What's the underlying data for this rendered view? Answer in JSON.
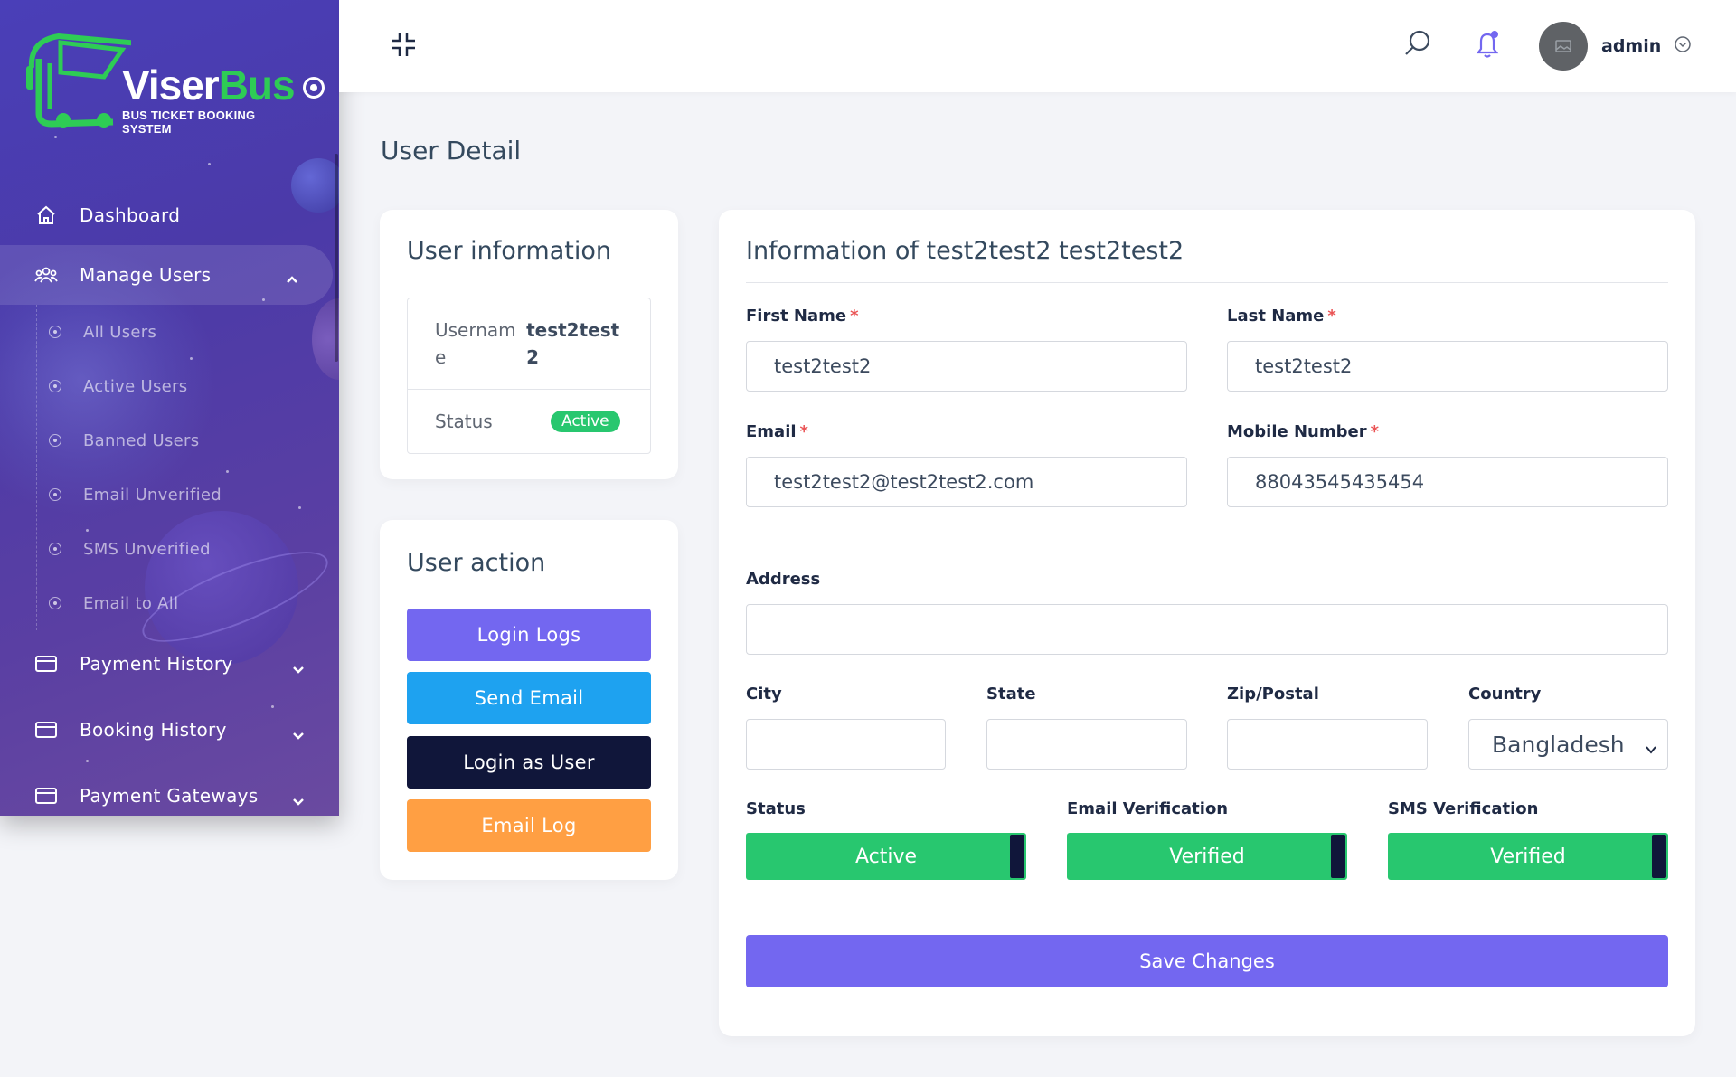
{
  "brand": {
    "name_part1": "Viser",
    "name_part2": "Bus",
    "subtitle": "BUS TICKET BOOKING SYSTEM"
  },
  "sidebar": {
    "items": [
      {
        "label": "Dashboard",
        "icon": "home-icon"
      },
      {
        "label": "Manage Users",
        "icon": "users-icon",
        "expanded": true
      },
      {
        "label": "Payment History",
        "icon": "credit-card-icon"
      },
      {
        "label": "Booking History",
        "icon": "credit-card-icon"
      },
      {
        "label": "Payment Gateways",
        "icon": "credit-card-icon"
      }
    ],
    "submenu": [
      {
        "label": "All Users"
      },
      {
        "label": "Active Users"
      },
      {
        "label": "Banned Users"
      },
      {
        "label": "Email Unverified"
      },
      {
        "label": "SMS Unverified"
      },
      {
        "label": "Email to All"
      }
    ]
  },
  "topbar": {
    "username": "admin"
  },
  "page": {
    "title": "User Detail"
  },
  "user_info": {
    "title": "User information",
    "username_label": "Username",
    "username_value": "test2test2",
    "status_label": "Status",
    "status_value": "Active"
  },
  "user_action": {
    "title": "User action",
    "buttons": [
      {
        "label": "Login Logs",
        "color": "#7367f0"
      },
      {
        "label": "Send Email",
        "color": "#1ea2f0"
      },
      {
        "label": "Login as User",
        "color": "#10163a"
      },
      {
        "label": "Email Log",
        "color": "#ff9f43"
      }
    ]
  },
  "form": {
    "title": "Information of test2test2 test2test2",
    "first_name": {
      "label": "First Name",
      "required": "*",
      "value": "test2test2"
    },
    "last_name": {
      "label": "Last Name",
      "required": "*",
      "value": "test2test2"
    },
    "email": {
      "label": "Email",
      "required": "*",
      "value": "test2test2@test2test2.com"
    },
    "mobile": {
      "label": "Mobile Number",
      "required": "*",
      "value": "88043545435454"
    },
    "address": {
      "label": "Address",
      "value": ""
    },
    "city": {
      "label": "City",
      "value": ""
    },
    "state": {
      "label": "State",
      "value": ""
    },
    "zip": {
      "label": "Zip/Postal",
      "value": ""
    },
    "country": {
      "label": "Country",
      "value": "Bangladesh"
    },
    "status": {
      "label": "Status",
      "value": "Active"
    },
    "email_verification": {
      "label": "Email Verification",
      "value": "Verified"
    },
    "sms_verification": {
      "label": "SMS Verification",
      "value": "Verified"
    },
    "save_label": "Save Changes"
  },
  "colors": {
    "sidebar_start": "#4a3fb8",
    "sidebar_end": "#6a4aa0",
    "primary": "#7367f0",
    "success": "#28c76f",
    "danger": "#ea5455"
  }
}
